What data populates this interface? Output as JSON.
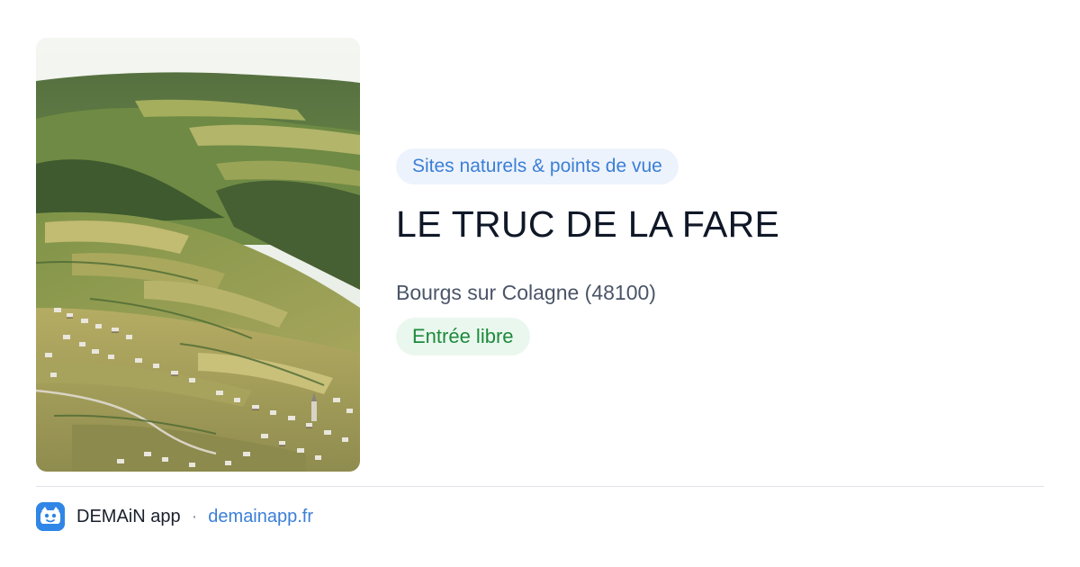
{
  "place": {
    "category": "Sites naturels & points de vue",
    "title": "LE TRUC DE LA FARE",
    "location": "Bourgs sur Colagne (48100)",
    "access": "Entrée libre"
  },
  "footer": {
    "app_name": "DEMAiN app",
    "separator": "·",
    "url": "demainapp.fr",
    "icon": "demain-app-logo-icon"
  },
  "colors": {
    "category_text": "#3b7fd6",
    "category_bg": "#edf3fc",
    "access_text": "#1e8a3c",
    "access_bg": "#eaf7ee",
    "title_text": "#101828",
    "brand_blue": "#2f86e6"
  }
}
